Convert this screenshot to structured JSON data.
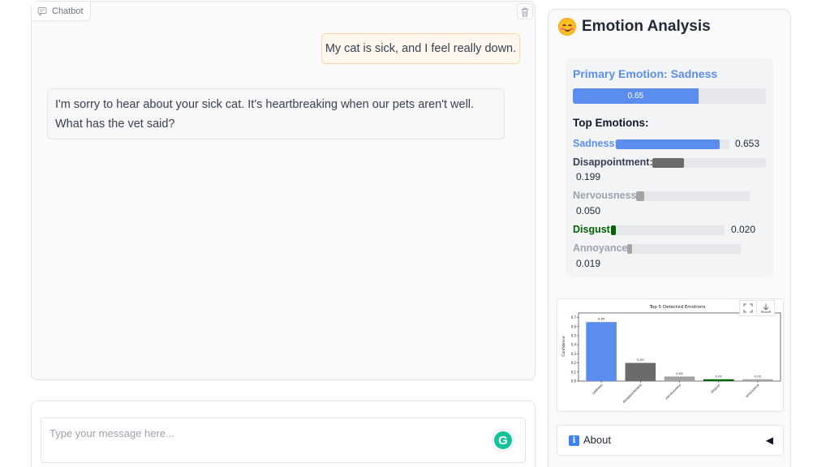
{
  "chatbot": {
    "label": "Chatbot",
    "messages": [
      {
        "role": "user",
        "text": "My cat is sick, and I feel really down."
      },
      {
        "role": "bot",
        "text": "I'm sorry to hear about your sick cat. It's heartbreaking when our pets aren't well. What has the vet said?"
      }
    ]
  },
  "input": {
    "placeholder": "Type your message here..."
  },
  "analysis": {
    "title": "Emotion Analysis",
    "primary_label": "Primary Emotion: Sadness",
    "primary_value": 0.65,
    "primary_value_text": "0.65",
    "top_title": "Top Emotions:",
    "emotions": [
      {
        "name": "Sadness:",
        "value": 0.653,
        "value_text": "0.653",
        "color": "#5b8def"
      },
      {
        "name": "Disappointment:",
        "value": 0.199,
        "value_text": "0.199",
        "color": "#6b6b6b"
      },
      {
        "name": "Nervousness:",
        "value": 0.05,
        "value_text": "0.050",
        "color": "#a3a3a3"
      },
      {
        "name": "Disgust:",
        "value": 0.02,
        "value_text": "0.020",
        "color": "#006400"
      },
      {
        "name": "Annoyance:",
        "value": 0.019,
        "value_text": "0.019",
        "color": "#a3a3a3"
      }
    ],
    "label_colors": [
      "#5b8def",
      "#374151",
      "#9ca3af",
      "#006400",
      "#9ca3af"
    ]
  },
  "chart_data": {
    "type": "bar",
    "title": "Top 5 Detected Emotions",
    "xlabel": "",
    "ylabel": "Confidence",
    "ylim": [
      0,
      0.75
    ],
    "yticks": [
      "0.0",
      "0.1",
      "0.2",
      "0.3",
      "0.4",
      "0.5",
      "0.6",
      "0.7"
    ],
    "categories": [
      "sadness",
      "disappointment",
      "nervousness",
      "disgust",
      "annoyance"
    ],
    "values": [
      0.65,
      0.2,
      0.05,
      0.02,
      0.02
    ],
    "value_labels": [
      "0.65",
      "0.20",
      "0.05",
      "0.02",
      "0.02"
    ],
    "colors": [
      "#5b8def",
      "#6b6b6b",
      "#a3a3a3",
      "#006400",
      "#a3a3a3"
    ],
    "grid": false
  },
  "about": {
    "label": "About",
    "icon": "info-icon",
    "caret": "◀"
  },
  "icons": {
    "chat": "chat-bubble-icon",
    "trash": "trash-icon",
    "fullscreen": "fullscreen-icon",
    "download": "download-icon",
    "grammarly": "grammarly-icon"
  }
}
